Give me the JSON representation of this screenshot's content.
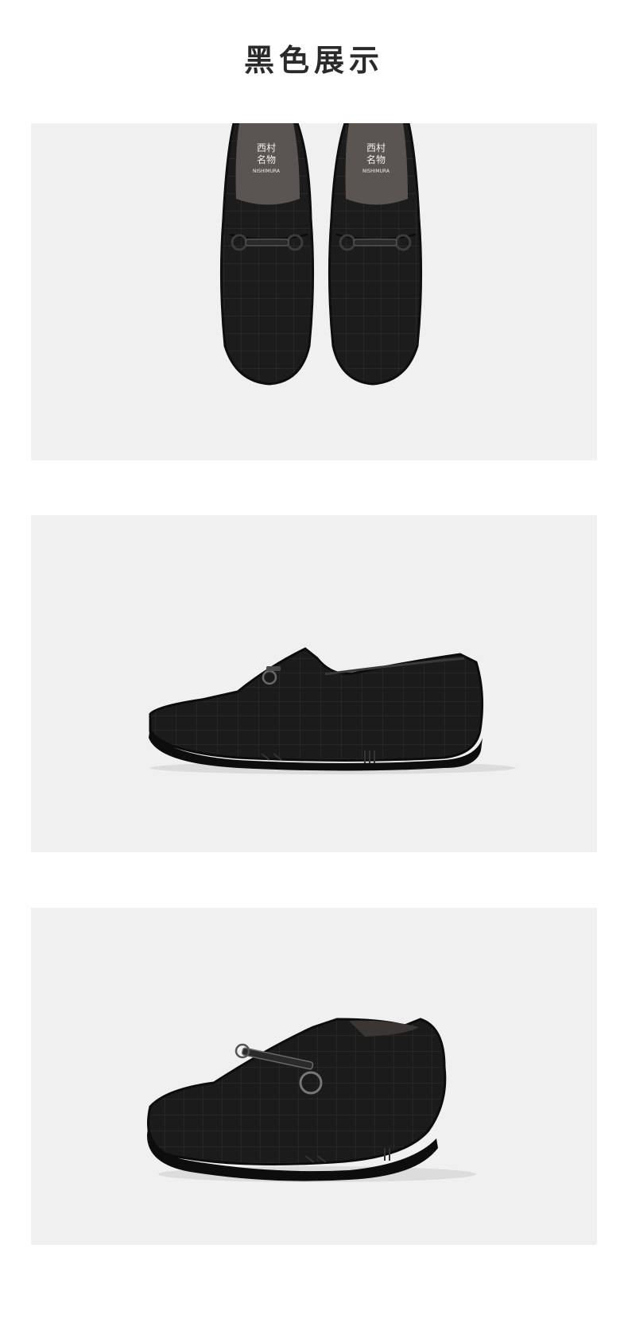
{
  "page": {
    "title": "黑色展示"
  },
  "photos": [
    {
      "name": "top-view",
      "insole_logo": [
        "西村",
        "名物",
        "NISHIMURA"
      ]
    },
    {
      "name": "side-view"
    },
    {
      "name": "three-quarter-view"
    }
  ],
  "colors": {
    "panel_background": "#f0f0f0",
    "shoe_black": "#1a1a1a",
    "insole_gray": "#5a5550",
    "title_text": "#2a2a2a"
  }
}
